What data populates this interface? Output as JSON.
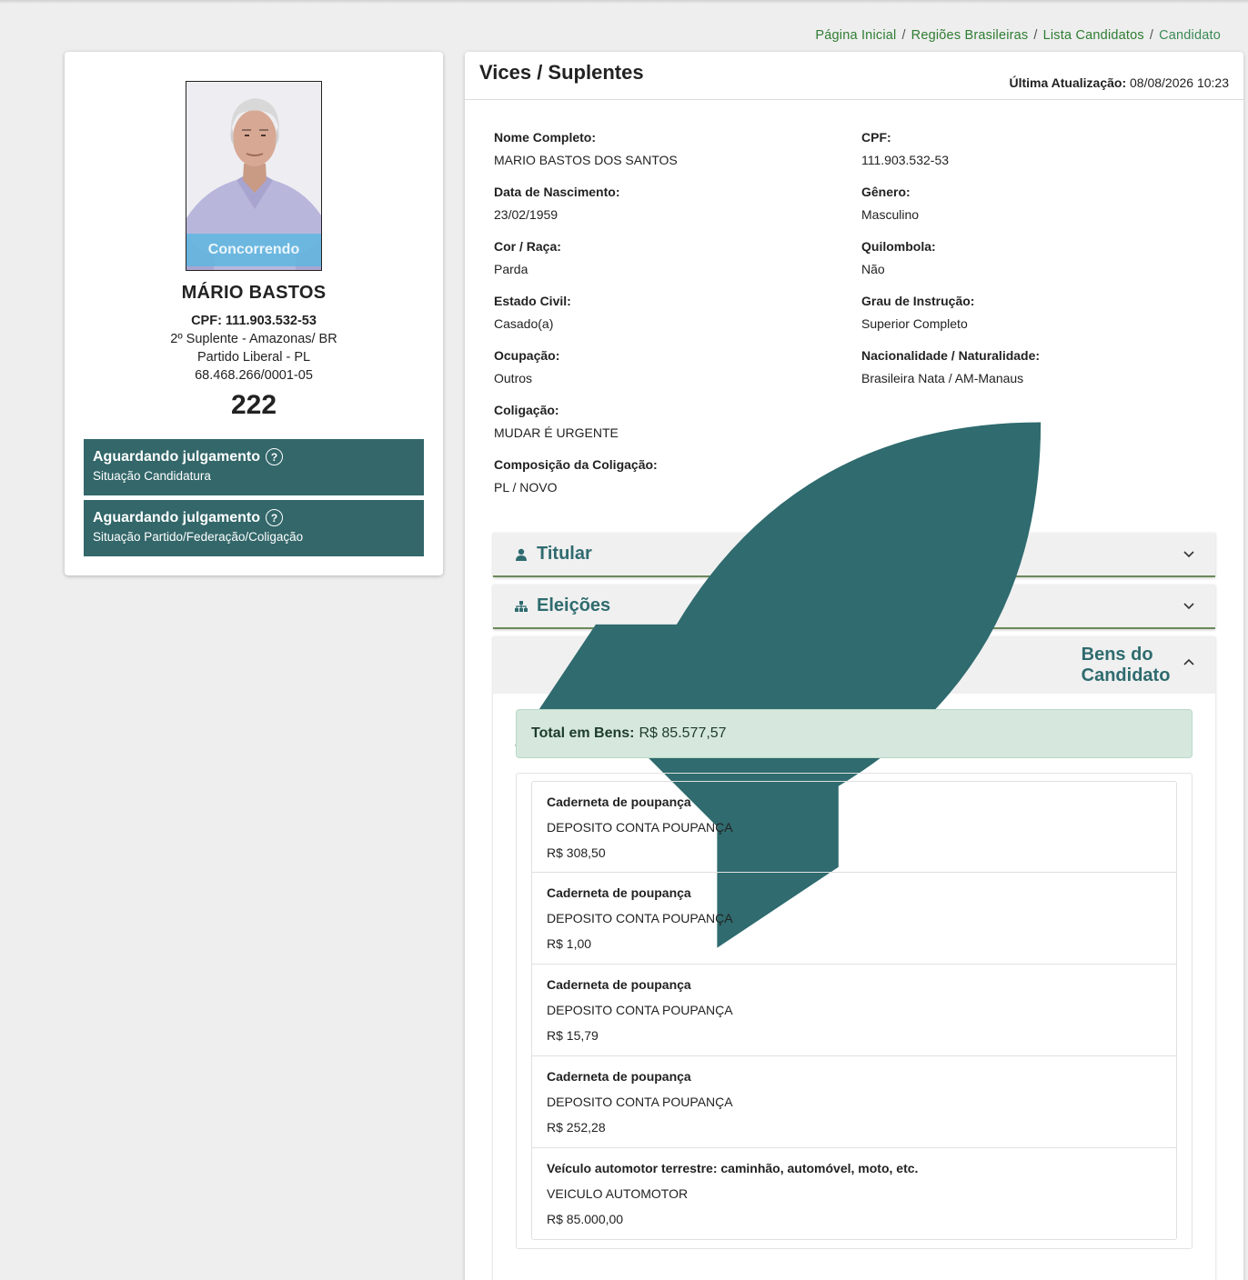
{
  "breadcrumb": {
    "items": [
      "Página Inicial",
      "Regiões Brasileiras",
      "Lista Candidatos"
    ],
    "current": "Candidato"
  },
  "profile": {
    "status_ribbon": "Concorrendo",
    "name": "MÁRIO BASTOS",
    "cpf": "CPF: 111.903.532-53",
    "role": "2º Suplente - Amazonas/ BR",
    "party": "Partido Liberal - PL",
    "cnpj": "68.468.266/0001-05",
    "number": "222",
    "statuses": [
      {
        "title": "Aguardando julgamento",
        "subtitle": "Situação Candidatura"
      },
      {
        "title": "Aguardando julgamento",
        "subtitle": "Situação Partido/Federação/Coligação"
      }
    ]
  },
  "panel": {
    "title": "Vices / Suplentes",
    "last_update_label": "Última Atualização:",
    "last_update_value": "08/08/2026 10:23"
  },
  "fields": {
    "nome_label": "Nome Completo:",
    "nome_value": "MARIO BASTOS DOS SANTOS",
    "cpf_label": "CPF:",
    "cpf_value": "111.903.532-53",
    "nasc_label": "Data de Nascimento:",
    "nasc_value": "23/02/1959",
    "genero_label": "Gênero:",
    "genero_value": "Masculino",
    "cor_label": "Cor / Raça:",
    "cor_value": "Parda",
    "quilombola_label": "Quilombola:",
    "quilombola_value": "Não",
    "civil_label": "Estado Civil:",
    "civil_value": "Casado(a)",
    "instrucao_label": "Grau de Instrução:",
    "instrucao_value": "Superior Completo",
    "ocupacao_label": "Ocupação:",
    "ocupacao_value": "Outros",
    "nacionalidade_label": "Nacionalidade / Naturalidade:",
    "nacionalidade_value": "Brasileira Nata / AM-Manaus",
    "coligacao_label": "Coligação:",
    "coligacao_value": "MUDAR É URGENTE",
    "composicao_label": "Composição da Coligação:",
    "composicao_value": "PL / NOVO"
  },
  "accordions": {
    "titular": "Titular",
    "eleicoes": "Eleições",
    "bens": "Bens do Candidato"
  },
  "bens": {
    "total_label": "Total em Bens:",
    "total_value": "R$ 85.577,57",
    "items": [
      {
        "type": "Caderneta de poupança",
        "desc": "DEPOSITO CONTA POUPANÇA",
        "value": "R$ 308,50"
      },
      {
        "type": "Caderneta de poupança",
        "desc": "DEPOSITO CONTA POUPANÇA",
        "value": "R$ 1,00"
      },
      {
        "type": "Caderneta de poupança",
        "desc": "DEPOSITO CONTA POUPANÇA",
        "value": "R$ 15,79"
      },
      {
        "type": "Caderneta de poupança",
        "desc": "DEPOSITO CONTA POUPANÇA",
        "value": "R$ 252,28"
      },
      {
        "type": "Veículo automotor terrestre: caminhão, automóvel, moto, etc.",
        "desc": "VEICULO AUTOMOTOR",
        "value": "R$ 85.000,00"
      }
    ]
  },
  "colors": {
    "accent": "#2f6b6f",
    "status_box": "#33676a",
    "breadcrumb": "#2e7d32",
    "total_bg": "#d6e8de",
    "ribbon": "#5bb7e0"
  },
  "icons": {
    "titular": "user-icon",
    "eleicoes": "sitemap-icon",
    "bens": "rocket-icon",
    "help": "question-circle-icon",
    "chevron": "chevron-icon"
  }
}
